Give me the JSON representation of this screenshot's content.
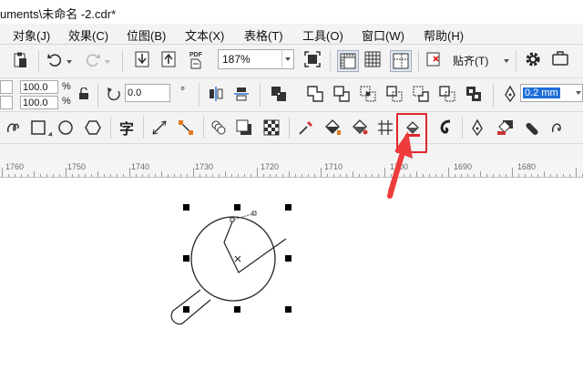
{
  "window": {
    "title": "uments\\未命名 -2.cdr*"
  },
  "menu": [
    {
      "label": "对象(J)"
    },
    {
      "label": "效果(C)"
    },
    {
      "label": "位图(B)"
    },
    {
      "label": "文本(X)"
    },
    {
      "label": "表格(T)"
    },
    {
      "label": "工具(O)"
    },
    {
      "label": "窗口(W)"
    },
    {
      "label": "帮助(H)"
    }
  ],
  "standard_toolbar": {
    "zoom_value": "187%",
    "snap_label": "贴齐(T)",
    "pdf_label": "PDF"
  },
  "property_bar": {
    "scale_x": "100.0",
    "scale_y": "100.0",
    "percent_x": "%",
    "percent_y": "%",
    "rotation": "0.0",
    "degree_symbol": "°",
    "outline_width": "0.2 mm"
  },
  "toolbox": {
    "text_tool_glyph": "字"
  },
  "ruler": {
    "labels": [
      "1760",
      "1750",
      "1740",
      "1730",
      "1720",
      "1710",
      "1700",
      "1690",
      "1680"
    ]
  },
  "colors": {
    "highlight": "#e0282e",
    "arrow": "#ee3b3b",
    "selection_handles": "#000000",
    "outline_width_bg": "#1e6fd9"
  },
  "icons": [
    "paste-icon",
    "undo-icon",
    "redo-icon",
    "import-icon",
    "export-icon",
    "publish-pdf-icon",
    "full-screen-icon",
    "rulers-icon",
    "grid-icon",
    "guidelines-icon",
    "snap-off-icon",
    "options-icon",
    "launch-icon",
    "lock-ratio-icon",
    "rotate-icon",
    "mirror-h-icon",
    "mirror-v-icon",
    "combine-icon",
    "weld-icon",
    "trim-icon",
    "intersect-icon",
    "simplify-icon",
    "front-minus-back-icon",
    "back-minus-front-icon",
    "create-boundary-icon",
    "pen-icon",
    "freehand-icon",
    "rectangle-icon",
    "ellipse-icon",
    "polygon-icon",
    "text-icon",
    "dimension-icon",
    "connector-icon",
    "blend-icon",
    "drop-shadow-icon",
    "transparency-icon",
    "eyedropper-icon",
    "interactive-fill-icon",
    "smart-fill-icon",
    "mesh-fill-icon",
    "outline-pen-icon",
    "smear-icon",
    "contour-icon",
    "eraser-icon",
    "knife-icon"
  ]
}
